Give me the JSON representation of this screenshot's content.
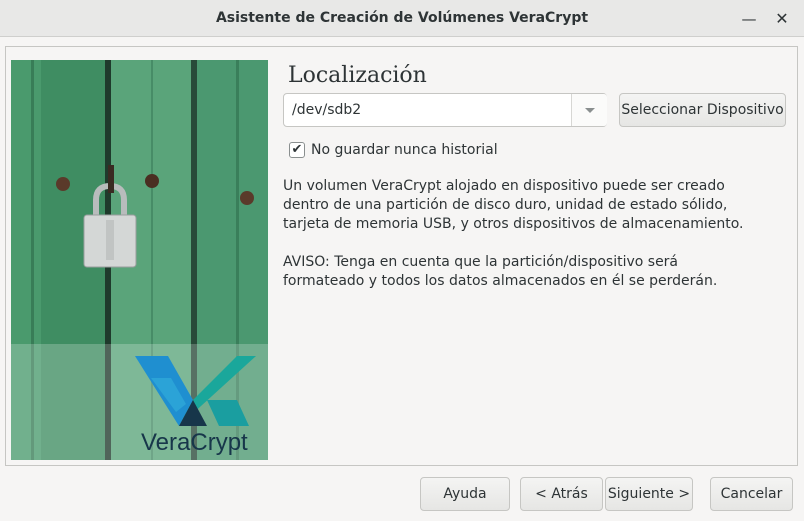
{
  "window": {
    "title": "Asistente de Creación de Volúmenes VeraCrypt",
    "minimize_glyph": "—",
    "close_glyph": "✕"
  },
  "banner": {
    "logo_text": "VeraCrypt"
  },
  "page": {
    "heading": "Localización",
    "device_path": "/dev/sdb2",
    "select_device_label": "Seleccionar Dispositivo",
    "never_save_history_label": "No guardar nunca historial",
    "never_save_history_checked": true,
    "info_text": "Un volumen VeraCrypt alojado en dispositivo puede ser creado\ndentro de una partición de disco duro, unidad de estado sólido,\ntarjeta de memoria USB, y otros dispositivos de almacenamiento.",
    "warning_text": "AVISO: Tenga en cuenta que la partición/dispositivo será\nformateado y todos los datos almacenados en él se perderán."
  },
  "footer": {
    "help_label": "Ayuda",
    "back_label": "< Atrás",
    "next_label": "Siguiente >",
    "cancel_label": "Cancelar"
  },
  "icons": {
    "minimize": "minimize-icon",
    "close": "close-icon",
    "dropdown": "chevron-down-icon",
    "checkbox": "checkmark-icon",
    "padlock": "padlock-icon"
  },
  "colors": {
    "banner_green": "#3c8a5f",
    "logo_blue": "#1f8fd0",
    "logo_teal": "#1aa79b",
    "logo_dark": "#17364a"
  }
}
